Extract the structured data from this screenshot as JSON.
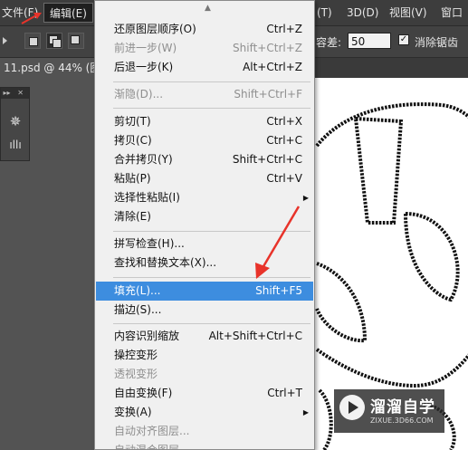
{
  "menubar": {
    "file": "文件(F)",
    "edit": "编辑(E)",
    "three_d": "3D(D)",
    "view": "视图(V)",
    "window": "窗口",
    "partial_mode_tail": "(T)"
  },
  "options_bar": {
    "tolerance_label": "容差:",
    "tolerance_value": "50",
    "antialias_label": "消除锯齿",
    "antialias_checked": true
  },
  "document_tab": {
    "title": "11.psd @ 44% (图"
  },
  "edit_menu": {
    "items": [
      {
        "label": "还原图层顺序(O)",
        "shortcut": "Ctrl+Z",
        "disabled": false
      },
      {
        "label": "前进一步(W)",
        "shortcut": "Shift+Ctrl+Z",
        "disabled": true
      },
      {
        "label": "后退一步(K)",
        "shortcut": "Alt+Ctrl+Z",
        "disabled": false
      },
      {
        "label": "渐隐(D)...",
        "shortcut": "Shift+Ctrl+F",
        "disabled": true
      },
      {
        "label": "剪切(T)",
        "shortcut": "Ctrl+X",
        "disabled": false
      },
      {
        "label": "拷贝(C)",
        "shortcut": "Ctrl+C",
        "disabled": false
      },
      {
        "label": "合并拷贝(Y)",
        "shortcut": "Shift+Ctrl+C",
        "disabled": false
      },
      {
        "label": "粘贴(P)",
        "shortcut": "Ctrl+V",
        "disabled": false
      },
      {
        "label": "选择性粘贴(I)",
        "shortcut": "",
        "disabled": false,
        "submenu": true
      },
      {
        "label": "清除(E)",
        "shortcut": "",
        "disabled": false
      },
      {
        "label": "拼写检查(H)...",
        "shortcut": "",
        "disabled": false
      },
      {
        "label": "查找和替换文本(X)...",
        "shortcut": "",
        "disabled": false
      },
      {
        "label": "填充(L)...",
        "shortcut": "Shift+F5",
        "disabled": false,
        "highlighted": true
      },
      {
        "label": "描边(S)...",
        "shortcut": "",
        "disabled": false
      },
      {
        "label": "内容识别缩放",
        "shortcut": "Alt+Shift+Ctrl+C",
        "disabled": false
      },
      {
        "label": "操控变形",
        "shortcut": "",
        "disabled": false
      },
      {
        "label": "透视变形",
        "shortcut": "",
        "disabled": true
      },
      {
        "label": "自由变换(F)",
        "shortcut": "Ctrl+T",
        "disabled": false
      },
      {
        "label": "变换(A)",
        "shortcut": "",
        "disabled": false,
        "submenu": true
      },
      {
        "label": "自动对齐图层...",
        "shortcut": "",
        "disabled": true
      },
      {
        "label": "自动混合图层...",
        "shortcut": "",
        "disabled": true
      }
    ]
  },
  "watermark": {
    "title": "溜溜自学",
    "subtitle": "ZIXUE.3D66.COM"
  },
  "icons": {
    "left_panel_1": "compass-wheel-icon",
    "left_panel_2": "brush-presets-icon"
  },
  "colors": {
    "highlight": "#3d8ddf",
    "annotation_arrow": "#e8332a"
  }
}
